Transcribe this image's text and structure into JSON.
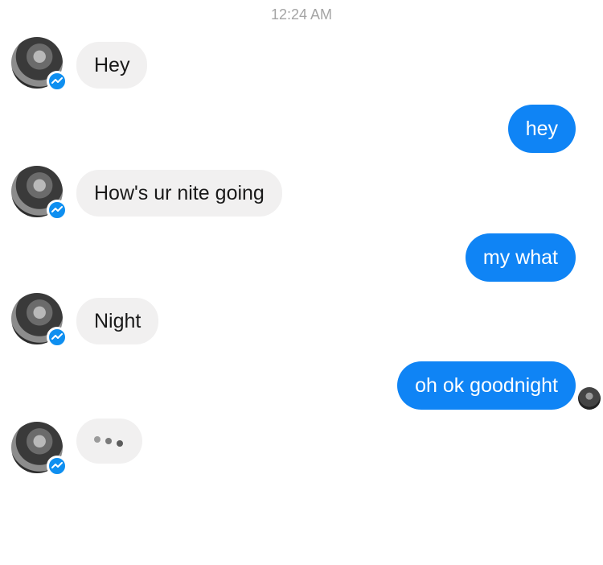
{
  "timestamp": "12:24 AM",
  "messages": [
    {
      "from": "them",
      "text": "Hey"
    },
    {
      "from": "me",
      "text": "hey"
    },
    {
      "from": "them",
      "text": "How's ur nite going"
    },
    {
      "from": "me",
      "text": "my what"
    },
    {
      "from": "them",
      "text": "Night"
    },
    {
      "from": "me",
      "text": "oh ok goodnight"
    }
  ],
  "typing_indicator": {
    "dot_colors": [
      "#9b9b9b",
      "#7a7a7a",
      "#5c5c5c"
    ]
  },
  "colors": {
    "outgoing_bubble": "#0f84f5",
    "incoming_bubble": "#f1f0f0",
    "messenger_badge": "#0f8ff0",
    "timestamp": "#a4a4a4"
  },
  "icons": {
    "avatar": "contact-avatar",
    "badge": "messenger-icon",
    "read_receipt": "read-receipt-avatar"
  }
}
